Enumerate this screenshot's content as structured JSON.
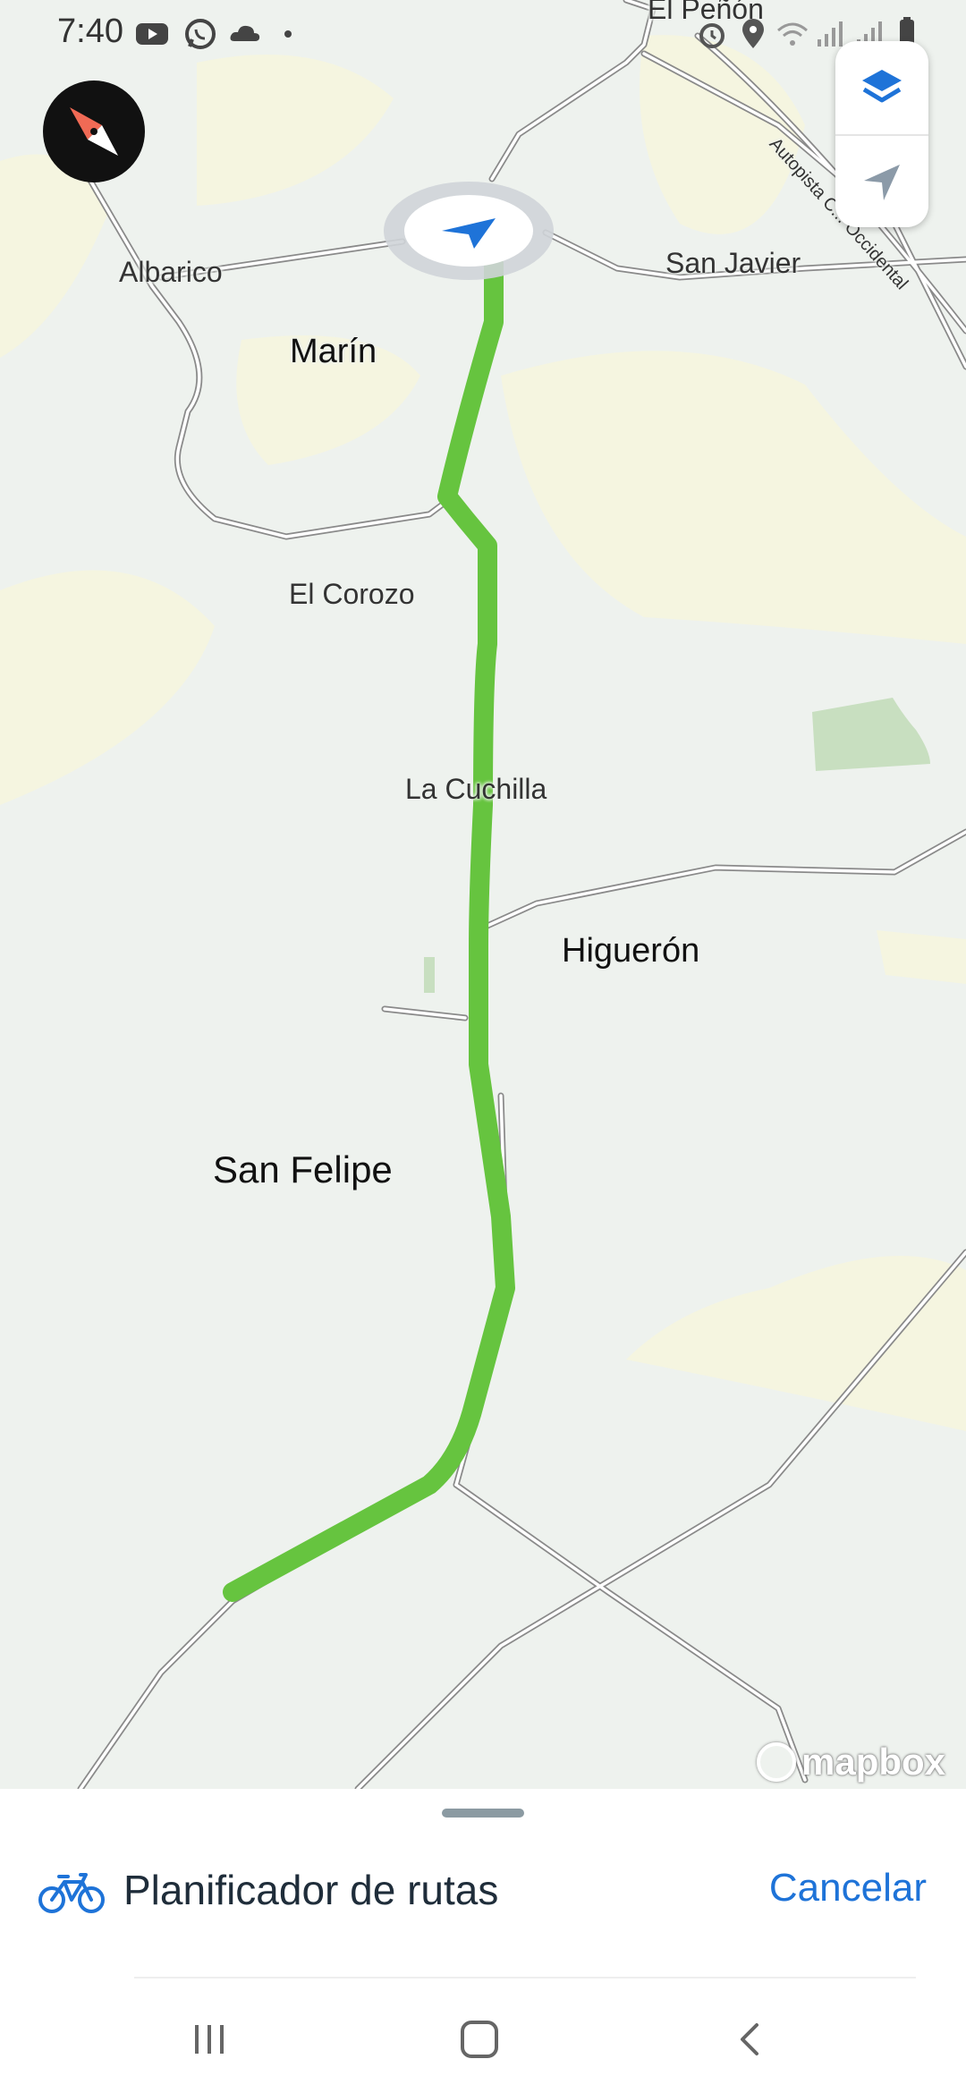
{
  "status_bar": {
    "time": "7:40",
    "left_icons": [
      "youtube-icon",
      "whatsapp-icon",
      "cloud-icon",
      "dot-icon"
    ],
    "right_icons": [
      "alarm-icon",
      "location-icon",
      "wifi-icon",
      "signal-icon",
      "signal-icon",
      "battery-icon"
    ]
  },
  "map": {
    "labels": {
      "el_penon": "El Peñón",
      "albarico": "Albarico",
      "san_javier": "San Javier",
      "marin": "Marín",
      "el_corozo": "El Corozo",
      "la_cuchilla": "La Cuchilla",
      "higueron": "Higuerón",
      "san_felipe": "San Felipe",
      "autopista": "Autopista C... Occidental"
    },
    "route_color": "#66c43f",
    "attribution": "mapbox"
  },
  "controls": {
    "layers_icon": "layers-icon",
    "locate_icon": "navigation-arrow-icon",
    "compass_icon": "compass-icon"
  },
  "bottom_sheet": {
    "title": "Planificador de rutas",
    "cancel_label": "Cancelar",
    "icon": "bicycle-icon"
  },
  "nav_bar": {
    "buttons": [
      "recent-apps-icon",
      "home-icon",
      "back-icon"
    ]
  }
}
